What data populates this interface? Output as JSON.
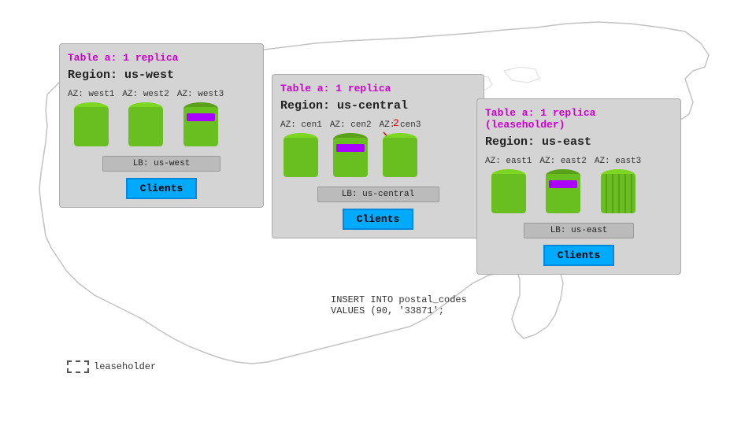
{
  "map": {
    "background": "#fff"
  },
  "panels": {
    "west": {
      "title": "Table a: 1 replica",
      "region": "Region: us-west",
      "azs": [
        "AZ: west1",
        "AZ: west2",
        "AZ: west3"
      ],
      "lb": "LB: us-west",
      "clients": "Clients",
      "leaseholder_az": 2
    },
    "central": {
      "title": "Table a: 1 replica",
      "region": "Region: us-central",
      "azs": [
        "AZ: cen1",
        "AZ: cen2",
        "AZ: cen3"
      ],
      "lb": "LB: us-central",
      "clients": "Clients",
      "leaseholder_az": 1,
      "arrow_label": "2",
      "sql": "INSERT INTO postal_codes\nVALUES (90, '33871';"
    },
    "east": {
      "title": "Table a: 1 replica (leaseholder)",
      "region": "Region: us-east",
      "azs": [
        "AZ: east1",
        "AZ: east2",
        "AZ: east3"
      ],
      "lb": "LB: us-east",
      "clients": "Clients",
      "leaseholder_az": 1
    }
  },
  "legend": {
    "label": "leaseholder"
  }
}
